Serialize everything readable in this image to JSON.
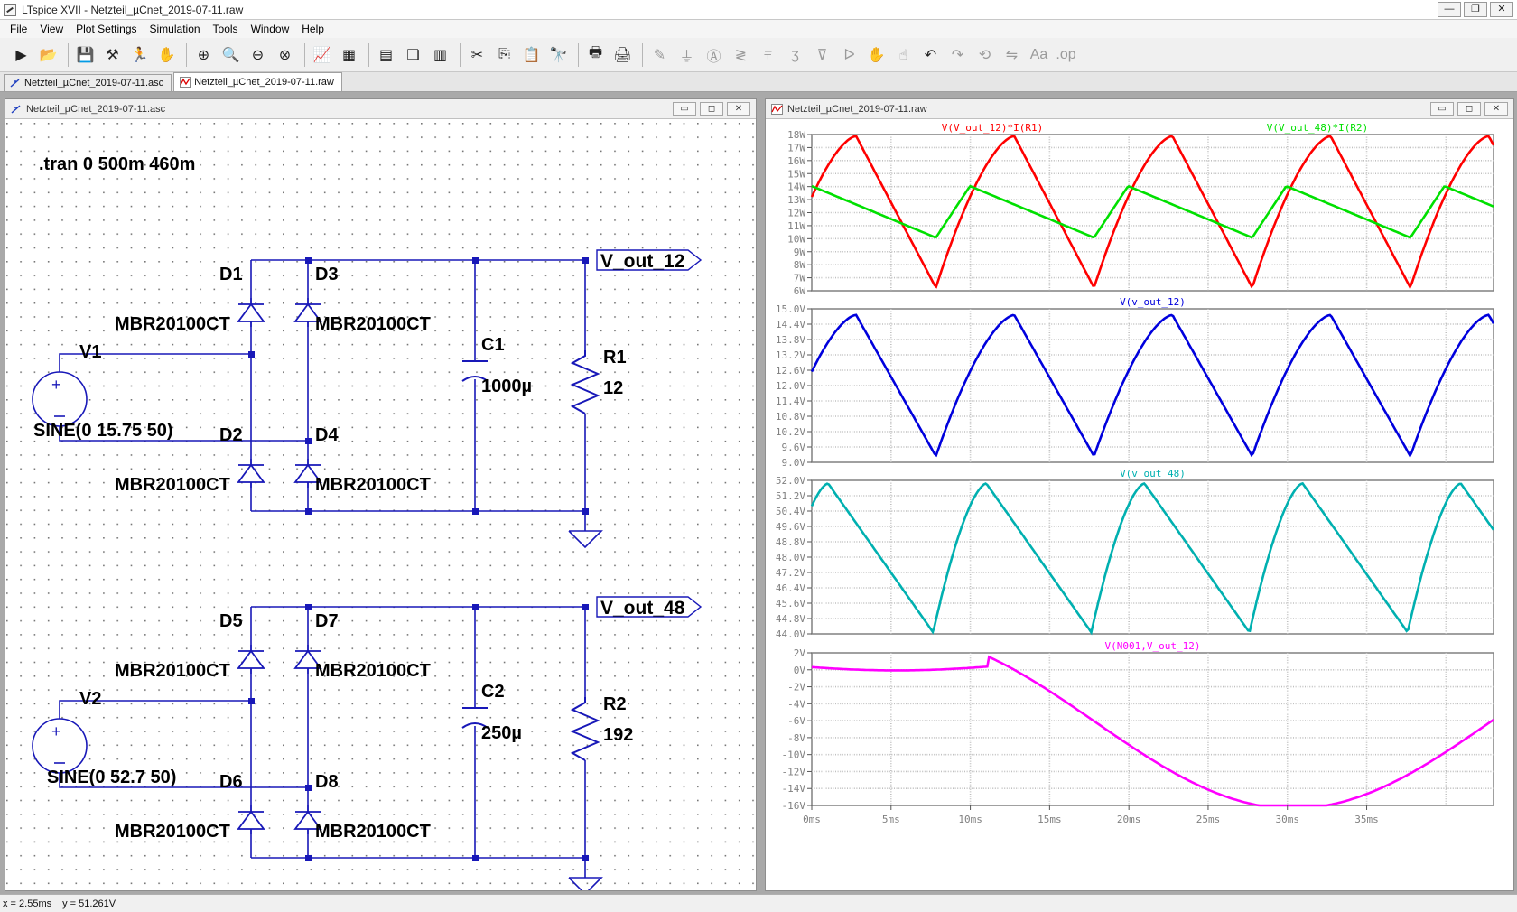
{
  "window": {
    "title": "LTspice XVII - Netzteil_µCnet_2019-07-11.raw",
    "buttons": [
      "—",
      "❐",
      "✕"
    ]
  },
  "menu": [
    "File",
    "View",
    "Plot Settings",
    "Simulation",
    "Tools",
    "Window",
    "Help"
  ],
  "toolbar_icons": [
    "run-icon",
    "open-icon",
    "save-icon",
    "control-panel-icon",
    "halt-icon",
    "pan-icon",
    "zoom-in-icon",
    "zoom-out-icon",
    "zoom-full-icon",
    "zoom-cancel-icon",
    "autorange-icon",
    "plot-settings-icon",
    "tile-horizontal-icon",
    "cascade-icon",
    "tile-vertical-icon",
    "cut-icon",
    "copy-icon",
    "paste-icon",
    "find-icon",
    "print-icon",
    "print-setup-icon",
    "wire-icon",
    "ground-icon",
    "label-icon",
    "resistor-icon",
    "capacitor-icon",
    "inductor-icon",
    "diode-icon",
    "component-icon",
    "move-icon",
    "drag-icon",
    "undo-icon",
    "redo-icon",
    "rotate-icon",
    "mirror-icon",
    "text-icon",
    "spice-directive-icon"
  ],
  "tabs": [
    {
      "label": "Netzteil_µCnet_2019-07-11.asc"
    },
    {
      "label": "Netzteil_µCnet_2019-07-11.raw"
    }
  ],
  "schematic": {
    "title": "Netzteil_µCnet_2019-07-11.asc",
    "directive": ".tran 0 500m 460m",
    "top": {
      "source_name": "V1",
      "source_value": "SINE(0 15.75 50)",
      "d1": "D1",
      "d2": "D2",
      "d3": "D3",
      "d4": "D4",
      "model": "MBR20100CT",
      "cap_name": "C1",
      "cap_value": "1000µ",
      "res_name": "R1",
      "res_value": "12",
      "net": "V_out_12"
    },
    "bottom": {
      "source_name": "V2",
      "source_value": "SINE(0 52.7 50)",
      "d1": "D5",
      "d2": "D6",
      "d3": "D7",
      "d4": "D8",
      "model": "MBR20100CT",
      "cap_name": "C2",
      "cap_value": "250µ",
      "res_name": "R2",
      "res_value": "192",
      "net": "V_out_48"
    }
  },
  "waveform": {
    "title": "Netzteil_µCnet_2019-07-11.raw",
    "x_ticks": [
      "0ms",
      "5ms",
      "10ms",
      "15ms",
      "20ms",
      "25ms",
      "30ms",
      "35ms"
    ],
    "panes": [
      {
        "traces": [
          {
            "label": "V(V_out_12)*I(R1)",
            "color": "#ff0000"
          },
          {
            "label": "V(V_out_48)*I(R2)",
            "color": "#00e000"
          }
        ],
        "y_ticks": [
          "18W",
          "17W",
          "16W",
          "15W",
          "14W",
          "13W",
          "12W",
          "11W",
          "10W",
          "9W",
          "8W",
          "7W",
          "6W"
        ]
      },
      {
        "traces": [
          {
            "label": "V(v_out_12)",
            "color": "#0000dd"
          }
        ],
        "y_ticks": [
          "15.0V",
          "14.4V",
          "13.8V",
          "13.2V",
          "12.6V",
          "12.0V",
          "11.4V",
          "10.8V",
          "10.2V",
          "9.6V",
          "9.0V"
        ]
      },
      {
        "traces": [
          {
            "label": "V(v_out_48)",
            "color": "#00b0b0"
          }
        ],
        "y_ticks": [
          "52.0V",
          "51.2V",
          "50.4V",
          "49.6V",
          "48.8V",
          "48.0V",
          "47.2V",
          "46.4V",
          "45.6V",
          "44.8V",
          "44.0V"
        ]
      },
      {
        "traces": [
          {
            "label": "V(N001,V_out_12)",
            "color": "#ff00ff"
          }
        ],
        "y_ticks": [
          "2V",
          "0V",
          "-2V",
          "-4V",
          "-6V",
          "-8V",
          "-10V",
          "-12V",
          "-14V",
          "-16V"
        ]
      }
    ]
  },
  "status": {
    "x": "x = 2.55ms",
    "y": "y = 51.261V"
  }
}
